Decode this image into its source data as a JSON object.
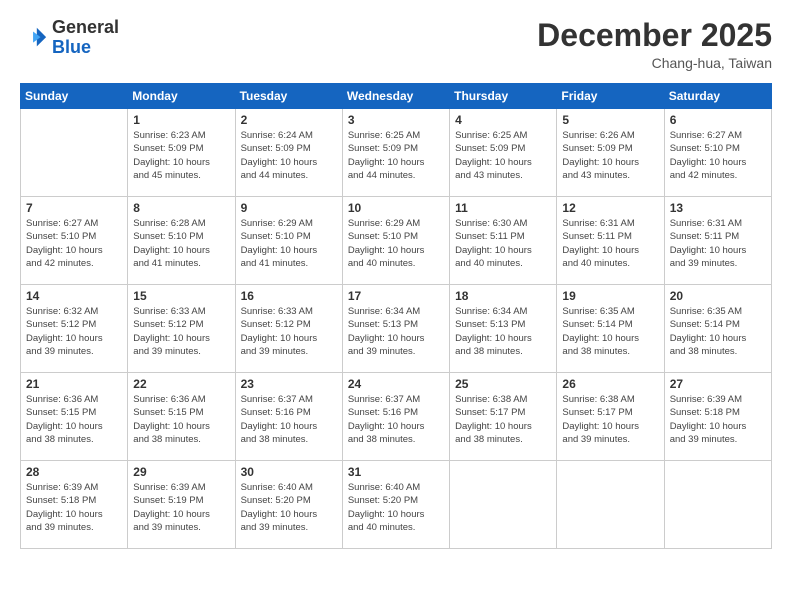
{
  "logo": {
    "line1": "General",
    "line2": "Blue"
  },
  "header": {
    "month_year": "December 2025",
    "location": "Chang-hua, Taiwan"
  },
  "days_of_week": [
    "Sunday",
    "Monday",
    "Tuesday",
    "Wednesday",
    "Thursday",
    "Friday",
    "Saturday"
  ],
  "weeks": [
    [
      {
        "num": "",
        "info": ""
      },
      {
        "num": "1",
        "info": "Sunrise: 6:23 AM\nSunset: 5:09 PM\nDaylight: 10 hours\nand 45 minutes."
      },
      {
        "num": "2",
        "info": "Sunrise: 6:24 AM\nSunset: 5:09 PM\nDaylight: 10 hours\nand 44 minutes."
      },
      {
        "num": "3",
        "info": "Sunrise: 6:25 AM\nSunset: 5:09 PM\nDaylight: 10 hours\nand 44 minutes."
      },
      {
        "num": "4",
        "info": "Sunrise: 6:25 AM\nSunset: 5:09 PM\nDaylight: 10 hours\nand 43 minutes."
      },
      {
        "num": "5",
        "info": "Sunrise: 6:26 AM\nSunset: 5:09 PM\nDaylight: 10 hours\nand 43 minutes."
      },
      {
        "num": "6",
        "info": "Sunrise: 6:27 AM\nSunset: 5:10 PM\nDaylight: 10 hours\nand 42 minutes."
      }
    ],
    [
      {
        "num": "7",
        "info": "Sunrise: 6:27 AM\nSunset: 5:10 PM\nDaylight: 10 hours\nand 42 minutes."
      },
      {
        "num": "8",
        "info": "Sunrise: 6:28 AM\nSunset: 5:10 PM\nDaylight: 10 hours\nand 41 minutes."
      },
      {
        "num": "9",
        "info": "Sunrise: 6:29 AM\nSunset: 5:10 PM\nDaylight: 10 hours\nand 41 minutes."
      },
      {
        "num": "10",
        "info": "Sunrise: 6:29 AM\nSunset: 5:10 PM\nDaylight: 10 hours\nand 40 minutes."
      },
      {
        "num": "11",
        "info": "Sunrise: 6:30 AM\nSunset: 5:11 PM\nDaylight: 10 hours\nand 40 minutes."
      },
      {
        "num": "12",
        "info": "Sunrise: 6:31 AM\nSunset: 5:11 PM\nDaylight: 10 hours\nand 40 minutes."
      },
      {
        "num": "13",
        "info": "Sunrise: 6:31 AM\nSunset: 5:11 PM\nDaylight: 10 hours\nand 39 minutes."
      }
    ],
    [
      {
        "num": "14",
        "info": "Sunrise: 6:32 AM\nSunset: 5:12 PM\nDaylight: 10 hours\nand 39 minutes."
      },
      {
        "num": "15",
        "info": "Sunrise: 6:33 AM\nSunset: 5:12 PM\nDaylight: 10 hours\nand 39 minutes."
      },
      {
        "num": "16",
        "info": "Sunrise: 6:33 AM\nSunset: 5:12 PM\nDaylight: 10 hours\nand 39 minutes."
      },
      {
        "num": "17",
        "info": "Sunrise: 6:34 AM\nSunset: 5:13 PM\nDaylight: 10 hours\nand 39 minutes."
      },
      {
        "num": "18",
        "info": "Sunrise: 6:34 AM\nSunset: 5:13 PM\nDaylight: 10 hours\nand 38 minutes."
      },
      {
        "num": "19",
        "info": "Sunrise: 6:35 AM\nSunset: 5:14 PM\nDaylight: 10 hours\nand 38 minutes."
      },
      {
        "num": "20",
        "info": "Sunrise: 6:35 AM\nSunset: 5:14 PM\nDaylight: 10 hours\nand 38 minutes."
      }
    ],
    [
      {
        "num": "21",
        "info": "Sunrise: 6:36 AM\nSunset: 5:15 PM\nDaylight: 10 hours\nand 38 minutes."
      },
      {
        "num": "22",
        "info": "Sunrise: 6:36 AM\nSunset: 5:15 PM\nDaylight: 10 hours\nand 38 minutes."
      },
      {
        "num": "23",
        "info": "Sunrise: 6:37 AM\nSunset: 5:16 PM\nDaylight: 10 hours\nand 38 minutes."
      },
      {
        "num": "24",
        "info": "Sunrise: 6:37 AM\nSunset: 5:16 PM\nDaylight: 10 hours\nand 38 minutes."
      },
      {
        "num": "25",
        "info": "Sunrise: 6:38 AM\nSunset: 5:17 PM\nDaylight: 10 hours\nand 38 minutes."
      },
      {
        "num": "26",
        "info": "Sunrise: 6:38 AM\nSunset: 5:17 PM\nDaylight: 10 hours\nand 39 minutes."
      },
      {
        "num": "27",
        "info": "Sunrise: 6:39 AM\nSunset: 5:18 PM\nDaylight: 10 hours\nand 39 minutes."
      }
    ],
    [
      {
        "num": "28",
        "info": "Sunrise: 6:39 AM\nSunset: 5:18 PM\nDaylight: 10 hours\nand 39 minutes."
      },
      {
        "num": "29",
        "info": "Sunrise: 6:39 AM\nSunset: 5:19 PM\nDaylight: 10 hours\nand 39 minutes."
      },
      {
        "num": "30",
        "info": "Sunrise: 6:40 AM\nSunset: 5:20 PM\nDaylight: 10 hours\nand 39 minutes."
      },
      {
        "num": "31",
        "info": "Sunrise: 6:40 AM\nSunset: 5:20 PM\nDaylight: 10 hours\nand 40 minutes."
      },
      {
        "num": "",
        "info": ""
      },
      {
        "num": "",
        "info": ""
      },
      {
        "num": "",
        "info": ""
      }
    ]
  ]
}
